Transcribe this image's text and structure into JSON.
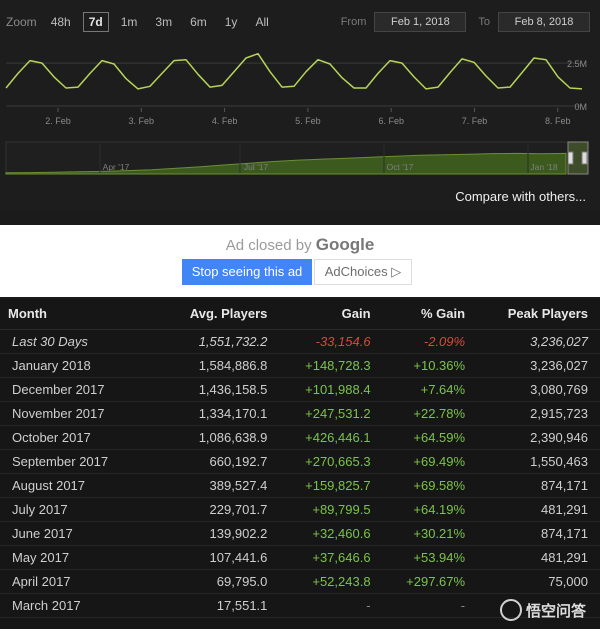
{
  "zoom": {
    "label": "Zoom",
    "options": [
      "48h",
      "7d",
      "1m",
      "3m",
      "6m",
      "1y",
      "All"
    ],
    "active": "7d"
  },
  "range": {
    "from_label": "From",
    "from_value": "Feb 1, 2018",
    "to_label": "To",
    "to_value": "Feb 8, 2018"
  },
  "chart_data": {
    "type": "line",
    "y_ticks": [
      "2.5M",
      "0M"
    ],
    "ylim": [
      0,
      3500000
    ],
    "x_tick_labels": [
      "2. Feb",
      "3. Feb",
      "4. Feb",
      "5. Feb",
      "6. Feb",
      "7. Feb",
      "8. Feb"
    ],
    "series": [
      {
        "values": [
          1050000,
          1900000,
          2650000,
          2500000,
          1700000,
          1050000,
          1100000,
          1900000,
          2650000,
          2450000,
          1600000,
          1000000,
          1150000,
          1900000,
          2650000,
          2700000,
          1850000,
          1100000,
          1200000,
          2000000,
          2800000,
          3050000,
          2000000,
          1100000,
          1150000,
          2000000,
          2700000,
          2450000,
          1650000,
          1050000,
          1050000,
          1900000,
          2650000,
          2500000,
          1700000,
          1000000,
          1100000,
          1950000,
          2750000,
          2550000,
          1750000,
          1050000,
          1100000,
          1950000,
          2800000,
          2700000,
          1700000,
          1050000,
          1000000
        ]
      }
    ],
    "navigator": {
      "labels": [
        "Apr '17",
        "Jul '17",
        "Oct '17",
        "Jan '18"
      ],
      "values": [
        0.05,
        0.06,
        0.07,
        0.09,
        0.11,
        0.14,
        0.18,
        0.24,
        0.3,
        0.38,
        0.45,
        0.52,
        0.58,
        0.62,
        0.66,
        0.7,
        0.74,
        0.78,
        0.8,
        0.82,
        0.85,
        0.86,
        0.84,
        0.86
      ]
    }
  },
  "compare_label": "Compare with others...",
  "ad": {
    "closed_by": "Ad closed by",
    "google": "Google",
    "stop_button": "Stop seeing this ad",
    "adchoices_button": "AdChoices ▷"
  },
  "table": {
    "headers": [
      "Month",
      "Avg. Players",
      "Gain",
      "% Gain",
      "Peak Players"
    ],
    "rows": [
      {
        "month": "Last 30 Days",
        "avg": "1,551,732.2",
        "gain": "-33,154.6",
        "pct": "-2.09%",
        "peak": "3,236,027",
        "sign": "neg"
      },
      {
        "month": "January 2018",
        "avg": "1,584,886.8",
        "gain": "+148,728.3",
        "pct": "+10.36%",
        "peak": "3,236,027",
        "sign": "pos"
      },
      {
        "month": "December 2017",
        "avg": "1,436,158.5",
        "gain": "+101,988.4",
        "pct": "+7.64%",
        "peak": "3,080,769",
        "sign": "pos"
      },
      {
        "month": "November 2017",
        "avg": "1,334,170.1",
        "gain": "+247,531.2",
        "pct": "+22.78%",
        "peak": "2,915,723",
        "sign": "pos"
      },
      {
        "month": "October 2017",
        "avg": "1,086,638.9",
        "gain": "+426,446.1",
        "pct": "+64.59%",
        "peak": "2,390,946",
        "sign": "pos"
      },
      {
        "month": "September 2017",
        "avg": "660,192.7",
        "gain": "+270,665.3",
        "pct": "+69.49%",
        "peak": "1,550,463",
        "sign": "pos"
      },
      {
        "month": "August 2017",
        "avg": "389,527.4",
        "gain": "+159,825.7",
        "pct": "+69.58%",
        "peak": "874,171",
        "sign": "pos"
      },
      {
        "month": "July 2017",
        "avg": "229,701.7",
        "gain": "+89,799.5",
        "pct": "+64.19%",
        "peak": "481,291",
        "sign": "pos"
      },
      {
        "month": "June 2017",
        "avg": "139,902.2",
        "gain": "+32,460.6",
        "pct": "+30.21%",
        "peak": "874,171",
        "sign": "pos"
      },
      {
        "month": "May 2017",
        "avg": "107,441.6",
        "gain": "+37,646.6",
        "pct": "+53.94%",
        "peak": "481,291",
        "sign": "pos"
      },
      {
        "month": "April 2017",
        "avg": "69,795.0",
        "gain": "+52,243.8",
        "pct": "+297.67%",
        "peak": "75,000",
        "sign": "pos"
      },
      {
        "month": "March 2017",
        "avg": "17,551.1",
        "gain": "-",
        "pct": "-",
        "peak": "",
        "sign": "dash"
      }
    ]
  },
  "watermark": "悟空问答"
}
